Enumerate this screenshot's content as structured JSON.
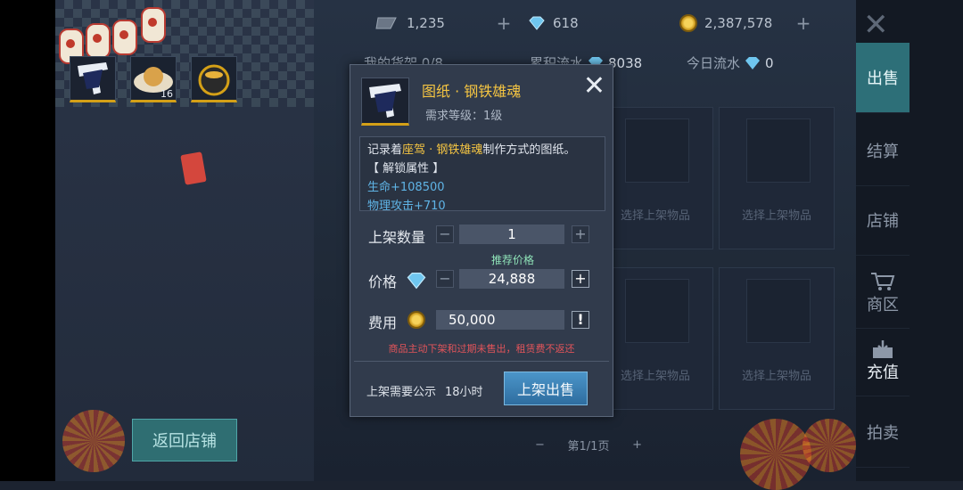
{
  "currency": {
    "cloud": "1,235",
    "diamond": "618",
    "gold": "2,387,578"
  },
  "shelf": {
    "label": "我的货架",
    "count": "0/8",
    "cumulative_label": "累积流水",
    "cumulative_value": "8038",
    "today_label": "今日流水",
    "today_value": "0",
    "slot_label": "选择上架物品",
    "pager": "第1/1页"
  },
  "inventory": [
    {
      "name": "blueprint",
      "count": ""
    },
    {
      "name": "cookies",
      "count": "16"
    },
    {
      "name": "pot",
      "count": ""
    }
  ],
  "back_button": "返回店铺",
  "nav": [
    "出售",
    "结算",
    "店铺",
    "商区",
    "充值",
    "拍卖"
  ],
  "dialog": {
    "title": "图纸 · 钢铁雄魂",
    "requirement": "需求等级：1级",
    "desc_prefix": "记录着",
    "desc_highlight": "座驾 · 钢铁雄魂",
    "desc_suffix": "制作方式的图纸。",
    "unlock": "【 解锁属性 】",
    "attr1": "生命+108500",
    "attr2": "物理攻击+710",
    "qty_label": "上架数量",
    "qty_value": "1",
    "recommend": "推荐价格",
    "price_label": "价格",
    "price_value": "24,888",
    "fee_label": "费用",
    "fee_value": "50,000",
    "warning": "商品主动下架和过期未售出，租赁费不返还",
    "publicity_label": "上架需要公示",
    "publicity_value": "18小时",
    "sell_button": "上架出售"
  },
  "colors": {
    "accent": "#2d6f78",
    "gold_text": "#f5c542",
    "attr_text": "#5fb4e6",
    "warning": "#e2545a"
  }
}
